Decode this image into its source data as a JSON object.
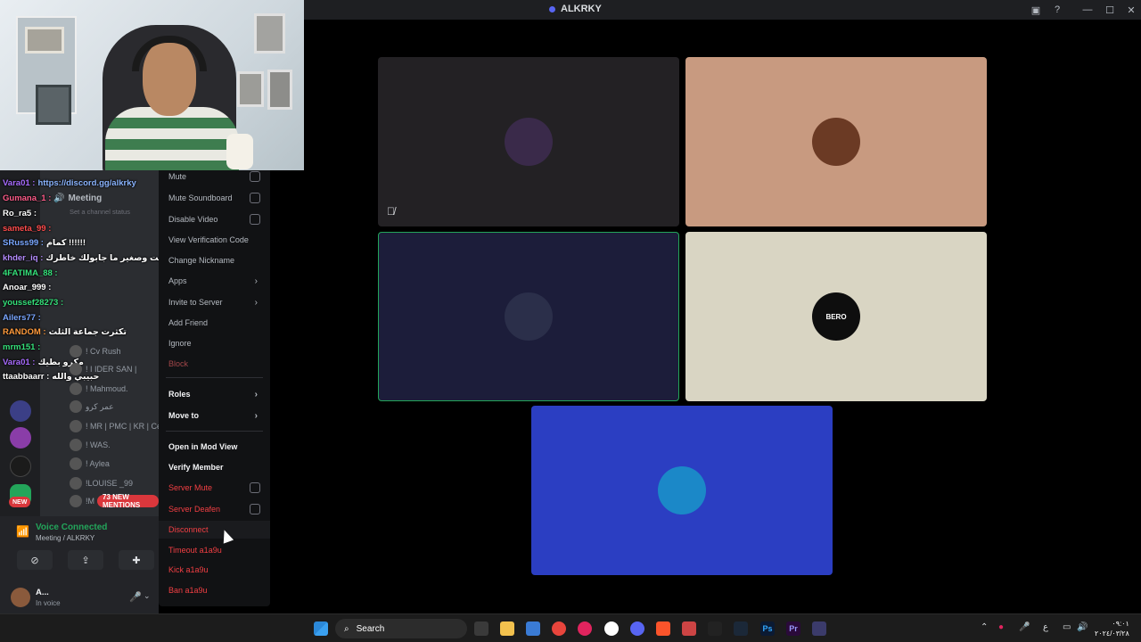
{
  "window": {
    "title": "ALKRKY"
  },
  "webcam": {
    "label": "streamer webcam"
  },
  "chat": [
    {
      "name": "Vara01 :",
      "msg": "https://discord.gg/alkrky",
      "color": "#a86cff",
      "msgColor": "#8ab4ff"
    },
    {
      "name": "Gumana_1 :",
      "msg": "",
      "color": "#ff5c8a",
      "msgColor": "#fff"
    },
    {
      "name": "Ro_ra5 :",
      "msg": "",
      "color": "#ffffff",
      "msgColor": "#fff"
    },
    {
      "name": "sameta_99 :",
      "msg": "",
      "color": "#ff4d4d",
      "msgColor": "#fff"
    },
    {
      "name": "SRuss99 :",
      "msg": "كمام !!!!!!",
      "color": "#7aa7ff",
      "msgColor": "#fff"
    },
    {
      "name": "khder_iq :",
      "msg": "مسالار حبيبي انت وصغير ما جابولك خاطرك!!",
      "color": "#b58cff",
      "msgColor": "#fff"
    },
    {
      "name": "4FATIMA_88 :",
      "msg": "",
      "color": "#35e07a",
      "msgColor": "#fff"
    },
    {
      "name": "Anoar_999 :",
      "msg": "",
      "color": "#ffffff",
      "msgColor": "#fff"
    },
    {
      "name": "youssef28273 :",
      "msg": "",
      "color": "#35e07a",
      "msgColor": "#fff"
    },
    {
      "name": "Ailers77 :",
      "msg": "",
      "color": "#7aa7ff",
      "msgColor": "#fff"
    },
    {
      "name": "RANDOM :",
      "msg": "تكثرت جماعة الثلث",
      "color": "#ff9a3c",
      "msgColor": "#fff"
    },
    {
      "name": "mrm151 :",
      "msg": "",
      "color": "#35e07a",
      "msgColor": "#fff"
    },
    {
      "name": "Vara01 :",
      "msg": "مكرو بطيك",
      "color": "#a86cff",
      "msgColor": "#fff"
    },
    {
      "name": "ttaabbaarr :",
      "msg": "حبيبي والله",
      "color": "#ffffff",
      "msgColor": "#fff"
    }
  ],
  "channel": {
    "name": "Meeting",
    "status": "Set a channel status"
  },
  "members": [
    {
      "name": "! Cv Rush"
    },
    {
      "name": "! I IDER SAN |"
    },
    {
      "name": "! Mahmoud."
    },
    {
      "name": "عمر كرو"
    },
    {
      "name": "! MR | PMC | KR | Ce"
    },
    {
      "name": "! WAS."
    },
    {
      "name": "! Aylea"
    },
    {
      "name": "!LOUISE _99"
    },
    {
      "name": "!M"
    }
  ],
  "badges": {
    "mentions": "73 NEW MENTIONS",
    "new": "NEW"
  },
  "voice": {
    "status": "Voice Connected",
    "channel": "Meeting / ALKRKY"
  },
  "user": {
    "name": "A...",
    "status": "In voice"
  },
  "context_menu": {
    "mute": "Mute",
    "mute_soundboard": "Mute Soundboard",
    "disable_video": "Disable Video",
    "view_verification": "View Verification Code",
    "change_nickname": "Change Nickname",
    "apps": "Apps",
    "invite": "Invite to Server",
    "add_friend": "Add Friend",
    "ignore": "Ignore",
    "block": "Block",
    "roles": "Roles",
    "move_to": "Move to",
    "mod_view": "Open in Mod View",
    "verify": "Verify Member",
    "server_mute": "Server Mute",
    "server_deafen": "Server Deafen",
    "disconnect": "Disconnect",
    "timeout": "Timeout a1a9u",
    "kick": "Kick a1a9u",
    "ban": "Ban a1a9u"
  },
  "tiles": [
    {
      "bg": "#232124",
      "avatar": "#3a2a4a",
      "label": ""
    },
    {
      "bg": "#c89a80",
      "avatar": "#6b3a24",
      "label": ""
    },
    {
      "bg": "#1c1d3a",
      "avatar": "#2b2f4a",
      "label": ""
    },
    {
      "bg": "#d9d5c3",
      "avatar": "#0e0e0e",
      "label": "BERO"
    },
    {
      "bg": "#2b3ec2",
      "avatar": "#1b88c8",
      "label": ""
    }
  ],
  "taskbar": {
    "search": "Search",
    "clock_time": "٠٩:٠١",
    "clock_date": "٢٠٢٤/٠٣/٢٨",
    "lang": "ع"
  }
}
